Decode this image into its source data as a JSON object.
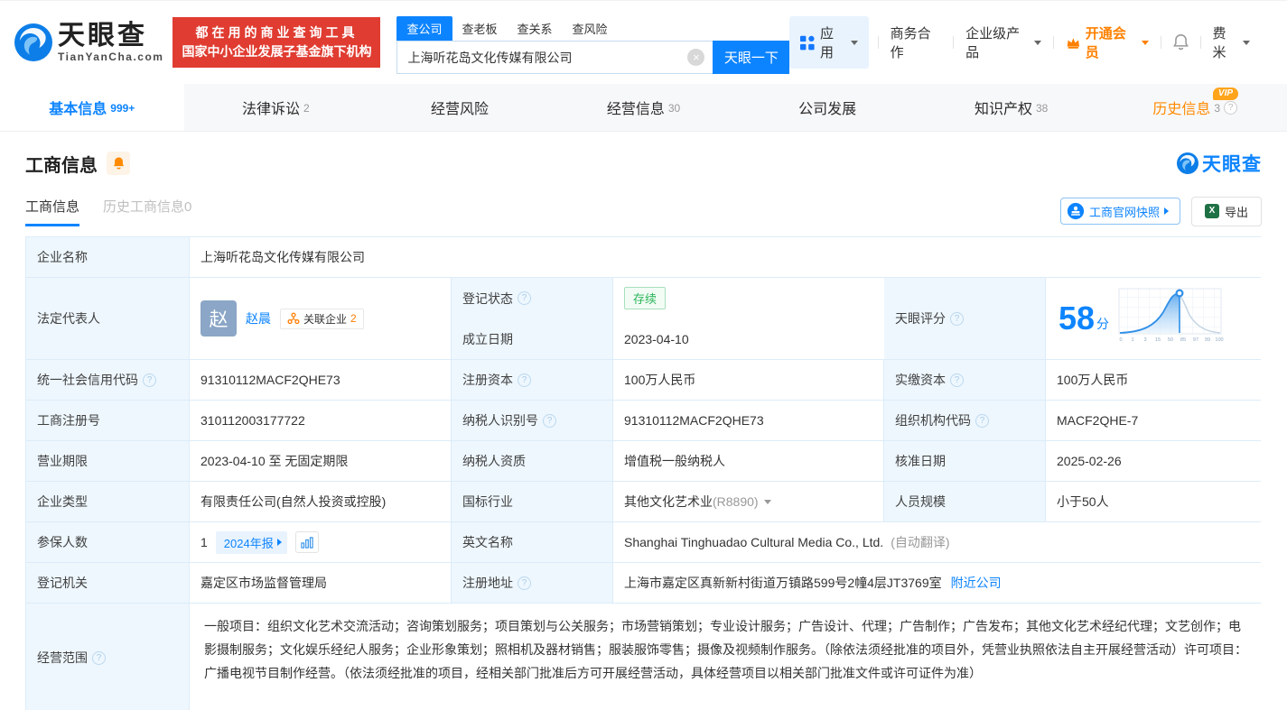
{
  "icons": {
    "help": "?",
    "clear": "×",
    "excel": "X"
  },
  "header": {
    "logo": {
      "title": "天眼查",
      "domain": "TianYanCha.com"
    },
    "slogan_line1": "都在用的商业查询工具",
    "slogan_line2": "国家中小企业发展子基金旗下机构",
    "search": {
      "tabs": [
        {
          "label": "查公司"
        },
        {
          "label": "查老板"
        },
        {
          "label": "查关系"
        },
        {
          "label": "查风险"
        }
      ],
      "value": "上海听花岛文化传媒有限公司",
      "button": "天眼一下"
    },
    "menu": {
      "apps": "应用",
      "cooperation": "商务合作",
      "enterprise": "企业级产品",
      "vip": "开通会员",
      "user": "费米"
    }
  },
  "nav_tabs": [
    {
      "label": "基本信息",
      "count": "999+"
    },
    {
      "label": "法律诉讼",
      "count": "2"
    },
    {
      "label": "经营风险",
      "count": ""
    },
    {
      "label": "经营信息",
      "count": "30"
    },
    {
      "label": "公司发展",
      "count": ""
    },
    {
      "label": "知识产权",
      "count": "38"
    },
    {
      "label": "历史信息",
      "count": "3",
      "vip": "VIP"
    }
  ],
  "section": {
    "title": "工商信息",
    "watermark": "天眼查",
    "subtabs": [
      {
        "label": "工商信息"
      },
      {
        "label": "历史工商信息0"
      }
    ],
    "snapshot_button": "工商官网快照",
    "export_button": "导出"
  },
  "table": {
    "company_name_label": "企业名称",
    "company_name": "上海听花岛文化传媒有限公司",
    "legal_rep_label": "法定代表人",
    "legal_rep_avatar": "赵",
    "legal_rep_name": "赵晨",
    "related_label": "关联企业",
    "related_count": "2",
    "reg_status_label": "登记状态",
    "reg_status": "存续",
    "establish_label": "成立日期",
    "establish_date": "2023-04-10",
    "score_label": "天眼评分",
    "score": "58",
    "score_unit": "分",
    "uscc_label": "统一社会信用代码",
    "uscc": "91310112MACF2QHE73",
    "reg_capital_label": "注册资本",
    "reg_capital": "100万人民币",
    "paid_capital_label": "实缴资本",
    "paid_capital": "100万人民币",
    "reg_no_label": "工商注册号",
    "reg_no": "310112003177722",
    "taxpayer_id_label": "纳税人识别号",
    "taxpayer_id": "91310112MACF2QHE73",
    "org_code_label": "组织机构代码",
    "org_code": "MACF2QHE-7",
    "term_label": "营业期限",
    "term": "2023-04-10 至 无固定期限",
    "taxpayer_quality_label": "纳税人资质",
    "taxpayer_quality": "增值税一般纳税人",
    "approval_label": "核准日期",
    "approval_date": "2025-02-26",
    "type_label": "企业类型",
    "type": "有限责任公司(自然人投资或控股)",
    "industry_label": "国标行业",
    "industry": "其他文化艺术业",
    "industry_code": "(R8890)",
    "staff_label": "人员规模",
    "staff": "小于50人",
    "insured_label": "参保人数",
    "insured": "1",
    "report_badge": "2024年报",
    "en_name_label": "英文名称",
    "en_name": "Shanghai Tinghuadao Cultural Media Co., Ltd.",
    "en_name_note": "(自动翻译)",
    "authority_label": "登记机关",
    "authority": "嘉定区市场监督管理局",
    "address_label": "注册地址",
    "address": "上海市嘉定区真新新村街道万镇路599号2幢4层JT3769室",
    "nearby_link": "附近公司",
    "scope_label": "经营范围",
    "scope": "一般项目：组织文化艺术交流活动；咨询策划服务；项目策划与公关服务；市场营销策划；专业设计服务；广告设计、代理；广告制作；广告发布；其他文化艺术经纪代理；文艺创作；电影摄制服务；文化娱乐经纪人服务；企业形象策划；照相机及器材销售；服装服饰零售；摄像及视频制作服务。（除依法须经批准的项目外，凭营业执照依法自主开展经营活动）许可项目：广播电视节目制作经营。（依法须经批准的项目，经相关部门批准后方可开展经营活动，具体经营项目以相关部门批准文件或许可证件为准）"
  },
  "chart_data": {
    "type": "area",
    "title": "天眼评分分布曲线",
    "score": 58,
    "x_ticks": [
      "0",
      "1",
      "3",
      "15",
      "50",
      "85",
      "97",
      "99",
      "100"
    ],
    "marker_position_percentile": 58,
    "legend": "off",
    "grid": "on",
    "accent_color": "#2f8fe8"
  },
  "colors": {
    "primary_blue": "#0d84ff",
    "brand_red": "#e03c31",
    "vip_orange": "#ff8000",
    "status_green": "#2bb558",
    "label_cell_bg": "#eef7fe",
    "table_border": "#dcecf8"
  }
}
